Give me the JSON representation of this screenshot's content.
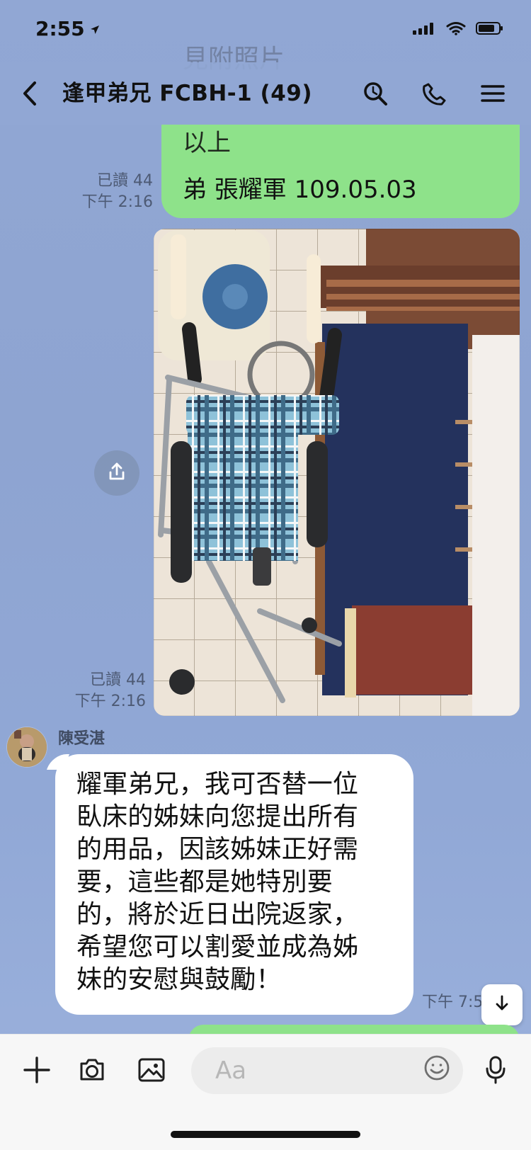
{
  "status_bar": {
    "time": "2:55"
  },
  "header": {
    "title": "逢甲弟兄 FCBH-1 (49)"
  },
  "messages": {
    "previous_faded_text": "見附照片",
    "top_bubble_line_1": "以上",
    "top_bubble_line_2": "弟 張耀軍 109.05.03",
    "meta_1": "已讀 44\n下午 2:16",
    "meta_2": "已讀 44\n下午 2:16",
    "sender_name": "陳受湛",
    "incoming_text": "耀軍弟兄，我可否替一位\n臥床的姊妹向您提出所有\n的用品，因該姊妹正好需\n要，這些都是她特別要\n的，將於近日出院返家，\n希望您可以割愛並成為姊\n妹的安慰與鼓勵！",
    "incoming_time": "下午 7:5"
  },
  "composer": {
    "placeholder": "Aa"
  },
  "colors": {
    "chat_background": "#8fa6d2",
    "outgoing_bubble": "#8ee28a",
    "incoming_bubble": "#ffffff",
    "composer_background": "#f7f7f7"
  },
  "icons": {
    "back": "chevron-left-icon",
    "search": "search-icon",
    "call": "phone-icon",
    "menu": "menu-icon",
    "share": "share-icon",
    "scroll_down": "arrow-down-icon",
    "plus": "plus-icon",
    "camera": "camera-icon",
    "image": "image-icon",
    "emoji": "emoji-icon",
    "mic": "microphone-icon"
  }
}
